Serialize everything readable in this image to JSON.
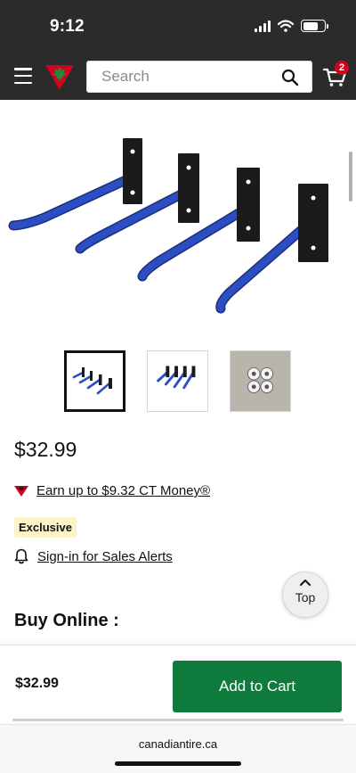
{
  "status_bar": {
    "time": "9:12"
  },
  "header": {
    "search_placeholder": "Search",
    "cart_count": "2"
  },
  "product": {
    "price": "$32.99",
    "ct_money_text": "Earn up to $9.32 CT Money®",
    "exclusive_badge": "Exclusive",
    "sales_alerts_text": "Sign-in for Sales Alerts",
    "buy_online_heading": "Buy Online :"
  },
  "top_button": {
    "label": "Top"
  },
  "bottom_bar": {
    "price": "$32.99",
    "add_to_cart_label": "Add to Cart"
  },
  "browser": {
    "url": "canadiantire.ca"
  },
  "colors": {
    "header_bg": "#2b2b2b",
    "add_to_cart_bg": "#0e7a3c",
    "badge_red": "#d6001c",
    "hook_blue": "#2b4fc2",
    "exclusive_bg": "#fdf3c8"
  },
  "icons": [
    "hamburger-menu-icon",
    "canadian-tire-logo",
    "search-icon",
    "cart-icon",
    "ct-triangle-icon",
    "bell-icon",
    "chevron-up-icon"
  ]
}
